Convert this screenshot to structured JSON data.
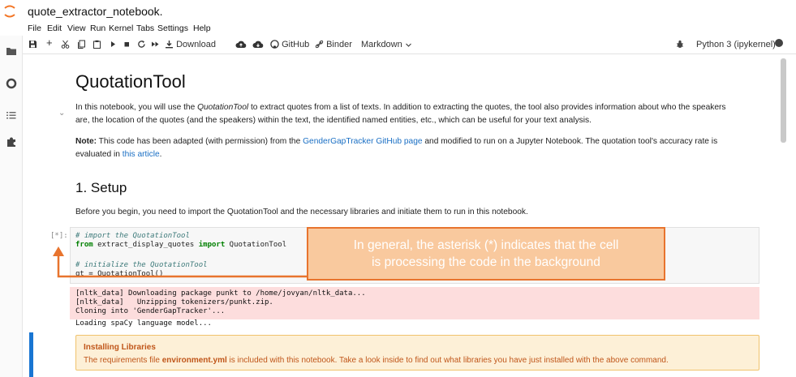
{
  "app": {
    "notebook_title": "quote_extractor_notebook.",
    "menu": [
      "File",
      "Edit",
      "View",
      "Run",
      "Kernel",
      "Tabs",
      "Settings",
      "Help"
    ]
  },
  "toolbar": {
    "download_label": "Download",
    "github_label": "GitHub",
    "binder_label": "Binder",
    "cell_type": "Markdown",
    "kernel_name": "Python 3 (ipykernel)"
  },
  "icons": {
    "logo": "jupyter-logo-icon",
    "rail": [
      "folder-icon",
      "running-circle-icon",
      "table-of-contents-icon",
      "extension-puzzle-icon"
    ],
    "toolbar": [
      "save-icon",
      "add-cell-icon",
      "cut-icon",
      "copy-icon",
      "paste-icon",
      "run-icon",
      "stop-icon",
      "restart-icon",
      "fast-forward-icon",
      "download-icon",
      "cloud-upload-icon",
      "cloud-download-icon",
      "github-icon",
      "binder-icon",
      "chevron-down-icon",
      "debugger-icon",
      "kernel-status-icon"
    ]
  },
  "colors": {
    "link": "#1a6fc4",
    "annotation_border": "#e8742e",
    "annotation_fill": "#f8c496",
    "stderr_bg": "#fddddd",
    "alert_text": "#c0561a",
    "active_cell": "#1976d2"
  },
  "notebook": {
    "heading1": "QuotationTool",
    "intro": {
      "before_em": "In this notebook, you will use the ",
      "em": "QuotationTool",
      "after_em": " to extract quotes from a list of texts. In addition to extracting the quotes, the tool also provides information about who the speakers",
      "line2": "are, the location of the quotes (and the speakers) within the text, the identified named entities, etc., which can be useful for your text analysis."
    },
    "note": {
      "bold": "Note:",
      "text1": " This code has been adapted (with permission) from the ",
      "link1": "GenderGapTracker GitHub page",
      "text2": " and modified to run on a Jupyter Notebook. The quotation tool's accuracy rate is",
      "line2_prefix": "evaluated in ",
      "link2": "this article",
      "line2_suffix": "."
    },
    "heading2": "1. Setup",
    "setup_text": "Before you begin, you need to import the QuotationTool and the necessary libraries and initiate them to run in this notebook.",
    "code_cell": {
      "prompt": "[*]:",
      "line1": "# import the QuotationTool",
      "line2_kw1": "from",
      "line2_mod": " extract_display_quotes ",
      "line2_kw2": "import",
      "line2_name": " QuotationTool",
      "line3": "# initialize the QuotationTool",
      "line4": "qt = QuotationTool()"
    },
    "output_lines": [
      "[nltk_data] Downloading package punkt to /home/jovyan/nltk_data...",
      "[nltk_data]   Unzipping tokenizers/punkt.zip.",
      "Cloning into 'GenderGapTracker'...",
      "Loading spaCy language model..."
    ],
    "alert": {
      "title": "Installing Libraries",
      "body_before": "The requirements file ",
      "body_bold": "environment.yml",
      "body_after": " is included with this notebook. Take a look inside to find out what libraries you have just installed with the above command."
    }
  },
  "annotation": {
    "line1": "In general, the asterisk (*) indicates that the cell",
    "line2": "is processing the code in the background"
  }
}
